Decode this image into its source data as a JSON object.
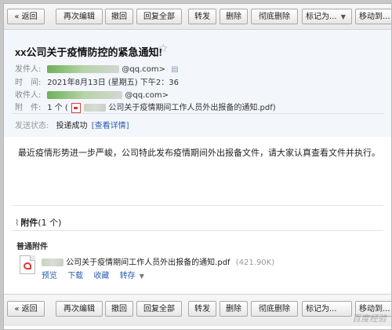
{
  "toolbar": {
    "back": "« 返回",
    "edit_again": "再次编辑",
    "recall": "撤回",
    "reply_all": "回复全部",
    "forward": "转发",
    "delete": "删除",
    "delete_perm": "彻底删除",
    "mark_as": "标记为...",
    "move_to": "移动到..."
  },
  "email": {
    "subject": "xx公司关于疫情防控的紧急通知!",
    "sender_label": "发件人:",
    "sender_value": "@qq.com>",
    "time_label": "时　间:",
    "time_value": "2021年8月13日 (星期五) 下午2：36",
    "recipient_label": "收件人:",
    "recipient_value": "@qq.com>",
    "attachment_label": "附　件:",
    "attachment_count": "1 个 (",
    "attachment_summary": "公司关于疫情期间工作人员外出报备的通知.pdf)",
    "status_label": "发送状态:",
    "status_value": "投递成功",
    "status_link": "[查看详情]",
    "body": "最近疫情形势进一步严峻，公司特此发布疫情期间外出报备文件，请大家认真查看文件并执行。"
  },
  "attachments": {
    "title": "附件",
    "count": "(1 个)",
    "kind": "普通附件",
    "file_name": "公司关于疫情期间工作人员外出报备的通知.pdf",
    "file_size": "(421.90K)",
    "actions": {
      "preview": "预览",
      "download": "下载",
      "favorite": "收藏",
      "save_to": "转存"
    }
  },
  "watermark": "百度经验"
}
